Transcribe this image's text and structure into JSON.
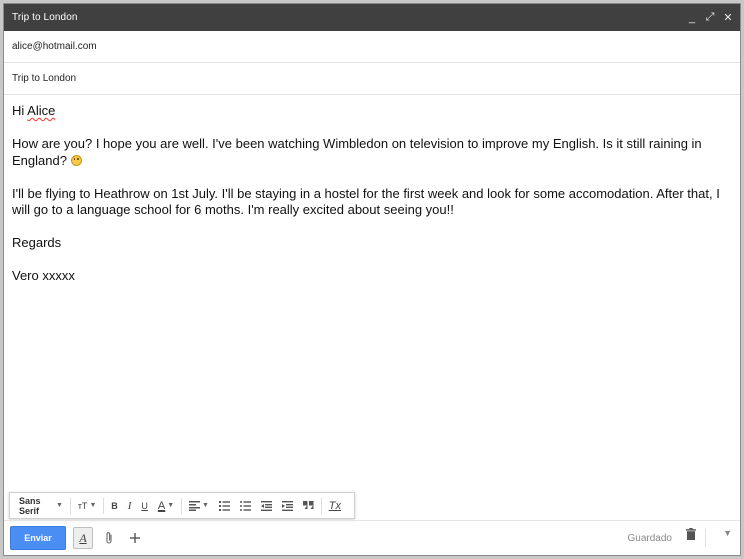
{
  "window": {
    "title": "Trip to London",
    "controls": {
      "minimize": "_",
      "expand": "⤢",
      "close": "✕"
    }
  },
  "to": {
    "value": "alice@hotmail.com"
  },
  "subject": {
    "value": "Trip to London"
  },
  "body": {
    "greeting_prefix": "Hi ",
    "greeting_name": "Alice",
    "p1": "How are you? I hope you are well. I've been watching Wimbledon on television to improve my English. Is it still raining in England?",
    "p2": "I'll be flying to Heathrow on 1st July. I'll be staying in a hostel for the first week and look for some accomodation. After that, I will go to a language school for 6 moths. I'm really excited about seeing you!!",
    "p3": "Regards",
    "p4": "Vero xxxxx"
  },
  "formatting": {
    "font": "Sans Serif",
    "size_icon": "тT",
    "bold": "B",
    "italic": "I",
    "underline": "U",
    "text_color": "A",
    "clear": "Tx"
  },
  "bottom": {
    "send_label": "Enviar",
    "format_toggle": "A",
    "status": "Guardado"
  },
  "colors": {
    "titlebar": "#404040",
    "send": "#4a8ef3"
  }
}
